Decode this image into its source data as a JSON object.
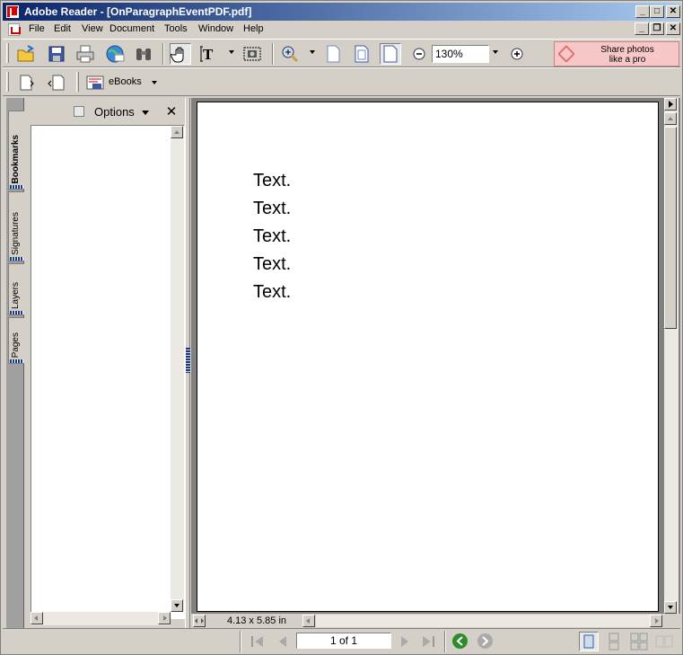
{
  "window": {
    "title": "Adobe Reader - [OnParagraphEventPDF.pdf]",
    "controls": {
      "minimize": "_",
      "maximize": "□",
      "close": "✕"
    },
    "doc_controls": {
      "minimize": "_",
      "restore": "❐",
      "close": "✕"
    }
  },
  "menu": {
    "items": [
      "File",
      "Edit",
      "View",
      "Document",
      "Tools",
      "Window",
      "Help"
    ]
  },
  "toolbar": {
    "tools": [
      {
        "icon": "open-folder-icon"
      },
      {
        "icon": "save-disk-icon"
      },
      {
        "icon": "print-icon"
      },
      {
        "icon": "email-globe-icon"
      },
      {
        "icon": "search-binoculars-icon"
      },
      {
        "icon": "hand-tool-icon"
      },
      {
        "icon": "select-text-icon"
      },
      {
        "icon": "snapshot-icon"
      },
      {
        "icon": "zoom-in-icon"
      },
      {
        "icon": "actual-size-icon"
      },
      {
        "icon": "fit-page-icon"
      },
      {
        "icon": "fit-width-icon"
      },
      {
        "icon": "zoom-out-icon"
      },
      {
        "icon": "zoom-plus-icon"
      }
    ],
    "zoom_value": "130%",
    "share": {
      "line1": "Share photos",
      "line2": "like a pro"
    }
  },
  "toolbar2": {
    "ebooks_label": "eBooks"
  },
  "nav_tabs": [
    "Bookmarks",
    "Signatures",
    "Layers",
    "Pages"
  ],
  "nav_pane": {
    "options_label": "Options",
    "close_label": "✕"
  },
  "document": {
    "lines": [
      "Text.",
      "Text.",
      "Text.",
      "Text.",
      "Text."
    ],
    "page_size": "4.13 x 5.85 in"
  },
  "statusbar": {
    "page_indicator": "1 of 1"
  },
  "colors": {
    "title_gradient_start": "#0a246a",
    "title_gradient_end": "#a6caf0",
    "chrome": "#d4d0c8",
    "doc_background": "#808080",
    "share_button": "#f8c8c8",
    "nav_green": "#2e8b2e"
  }
}
